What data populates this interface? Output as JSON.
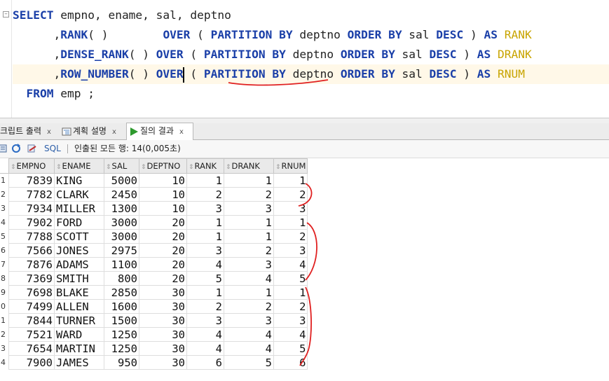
{
  "editor": {
    "fold_glyph": "−",
    "line1": {
      "select": "SELECT",
      "cols": " empno, ename, sal, deptno"
    },
    "rank_lines": [
      {
        "indent": "      ,",
        "fn": "RANK",
        "parens": "( )",
        "gap": "        ",
        "over": "OVER",
        "open": " ( ",
        "partition": "PARTITION BY",
        "pcol": " deptno ",
        "order": "ORDER BY",
        "ocol": " sal ",
        "desc": "DESC",
        "close": " ) ",
        "as": "AS",
        "alias": " RANK"
      },
      {
        "indent": "      ,",
        "fn": "DENSE_RANK",
        "parens": "( ) ",
        "gap": "",
        "over": "OVER",
        "open": " ( ",
        "partition": "PARTITION BY",
        "pcol": " deptno ",
        "order": "ORDER BY",
        "ocol": " sal ",
        "desc": "DESC",
        "close": " ) ",
        "as": "AS",
        "alias": " DRANK"
      },
      {
        "indent": "      ,",
        "fn": "ROW_NUMBER",
        "parens": "( ) ",
        "gap": "",
        "over": "OVER",
        "open": " ( ",
        "partition": "PARTITION BY",
        "pcol": " deptno ",
        "order": "ORDER BY",
        "ocol": " sal ",
        "desc": "DESC",
        "close": " ) ",
        "as": "AS",
        "alias": " RNUM"
      }
    ],
    "line5": {
      "indent": "  ",
      "from": "FROM",
      "rest": " emp ;"
    }
  },
  "tabs": [
    {
      "label": "크립트 출력",
      "close": "x"
    },
    {
      "label": "계획 설명",
      "close": "x"
    },
    {
      "label": "질의 결과",
      "close": "x"
    }
  ],
  "toolbar": {
    "sql_label": "SQL",
    "status": "인출된 모든 행: 14(0,005초)"
  },
  "colors": {
    "keyword": "#1a3fa8",
    "alias": "#c8a400",
    "annotation": "#e02020"
  },
  "result": {
    "columns": [
      "EMPNO",
      "ENAME",
      "SAL",
      "DEPTNO",
      "RANK",
      "DRANK",
      "RNUM"
    ],
    "sort_glyph": "⇕",
    "row_numbers": [
      "1",
      "2",
      "3",
      "4",
      "5",
      "6",
      "7",
      "8",
      "9",
      "0",
      "1",
      "2",
      "3",
      "4"
    ],
    "rows": [
      [
        "7839",
        "KING",
        "5000",
        "10",
        "1",
        "1",
        "1"
      ],
      [
        "7782",
        "CLARK",
        "2450",
        "10",
        "2",
        "2",
        "2"
      ],
      [
        "7934",
        "MILLER",
        "1300",
        "10",
        "3",
        "3",
        "3"
      ],
      [
        "7902",
        "FORD",
        "3000",
        "20",
        "1",
        "1",
        "1"
      ],
      [
        "7788",
        "SCOTT",
        "3000",
        "20",
        "1",
        "1",
        "2"
      ],
      [
        "7566",
        "JONES",
        "2975",
        "20",
        "3",
        "2",
        "3"
      ],
      [
        "7876",
        "ADAMS",
        "1100",
        "20",
        "4",
        "3",
        "4"
      ],
      [
        "7369",
        "SMITH",
        "800",
        "20",
        "5",
        "4",
        "5"
      ],
      [
        "7698",
        "BLAKE",
        "2850",
        "30",
        "1",
        "1",
        "1"
      ],
      [
        "7499",
        "ALLEN",
        "1600",
        "30",
        "2",
        "2",
        "2"
      ],
      [
        "7844",
        "TURNER",
        "1500",
        "30",
        "3",
        "3",
        "3"
      ],
      [
        "7521",
        "WARD",
        "1250",
        "30",
        "4",
        "4",
        "4"
      ],
      [
        "7654",
        "MARTIN",
        "1250",
        "30",
        "4",
        "4",
        "5"
      ],
      [
        "7900",
        "JAMES",
        "950",
        "30",
        "6",
        "5",
        "6"
      ]
    ]
  }
}
